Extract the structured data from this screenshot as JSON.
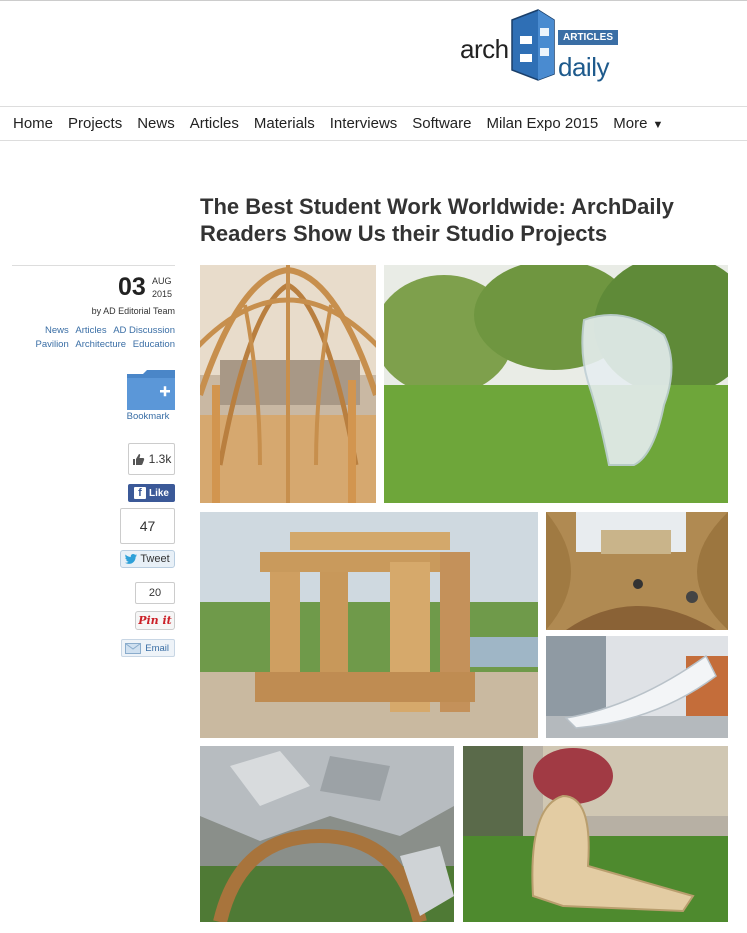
{
  "logo": {
    "left": "arch",
    "right": "daily",
    "badge": "ARTICLES"
  },
  "nav": {
    "items": [
      "Home",
      "Projects",
      "News",
      "Articles",
      "Materials",
      "Interviews",
      "Software",
      "Milan Expo 2015",
      "More"
    ],
    "more_caret": "▼"
  },
  "article": {
    "title": "The Best Student Work Worldwide: ArchDaily Readers Show Us their Studio Projects"
  },
  "sidebar": {
    "date_day": "03",
    "date_month": "AUG",
    "date_year": "2015",
    "author": "by AD Editorial Team",
    "tags_line1": [
      "News",
      "Articles",
      "AD Discussion"
    ],
    "tags_line2": [
      "Pavilion",
      "Architecture",
      "Education"
    ],
    "bookmark_label": "Bookmark",
    "facebook_count": "1.3k",
    "facebook_label": "Like",
    "twitter_count": "47",
    "twitter_label": "Tweet",
    "pinterest_count": "20",
    "pinterest_label": "Pin it",
    "email_label": "Email"
  },
  "colors": {
    "brand_blue": "#3a6ea5",
    "facebook": "#3b5998",
    "pinterest": "#cb2027"
  }
}
